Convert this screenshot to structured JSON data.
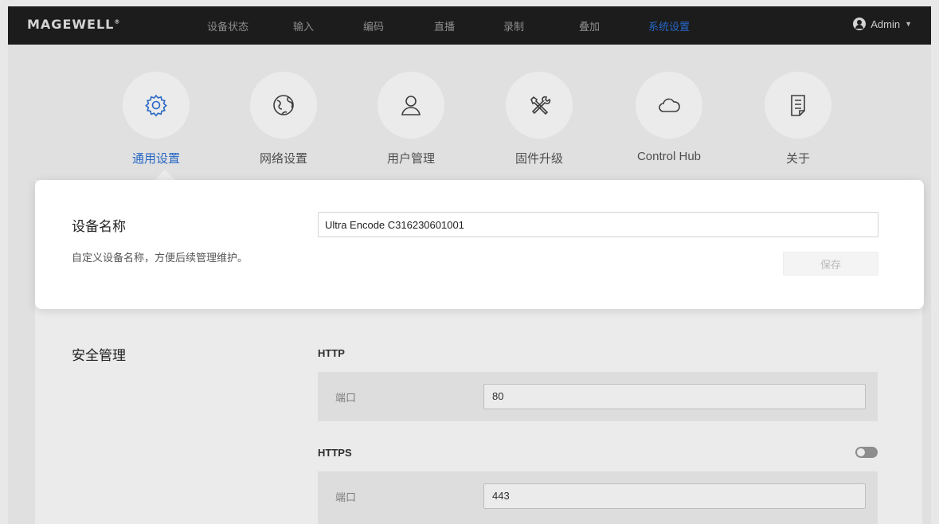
{
  "header": {
    "logo": "MAGEWELL",
    "nav": [
      {
        "label": "设备状态"
      },
      {
        "label": "输入"
      },
      {
        "label": "编码"
      },
      {
        "label": "直播"
      },
      {
        "label": "录制"
      },
      {
        "label": "叠加"
      },
      {
        "label": "系统设置",
        "active": true
      }
    ],
    "user": "Admin"
  },
  "tiles": [
    {
      "label": "通用设置",
      "icon": "gear-icon",
      "active": true
    },
    {
      "label": "网络设置",
      "icon": "globe-icon"
    },
    {
      "label": "用户管理",
      "icon": "user-icon"
    },
    {
      "label": "固件升级",
      "icon": "tools-icon"
    },
    {
      "label": "Control Hub",
      "icon": "cloud-icon"
    },
    {
      "label": "关于",
      "icon": "document-icon"
    }
  ],
  "device_name": {
    "title": "设备名称",
    "description": "自定义设备名称，方便后续管理维护。",
    "value": "Ultra Encode C316230601001",
    "save_label": "保存"
  },
  "security": {
    "title": "安全管理",
    "http": {
      "label": "HTTP",
      "port_label": "端口",
      "port": "80"
    },
    "https": {
      "label": "HTTPS",
      "port_label": "端口",
      "port": "443",
      "enabled": false
    }
  },
  "colors": {
    "accent": "#2a6fd6",
    "topbar": "#1f1f1f"
  }
}
